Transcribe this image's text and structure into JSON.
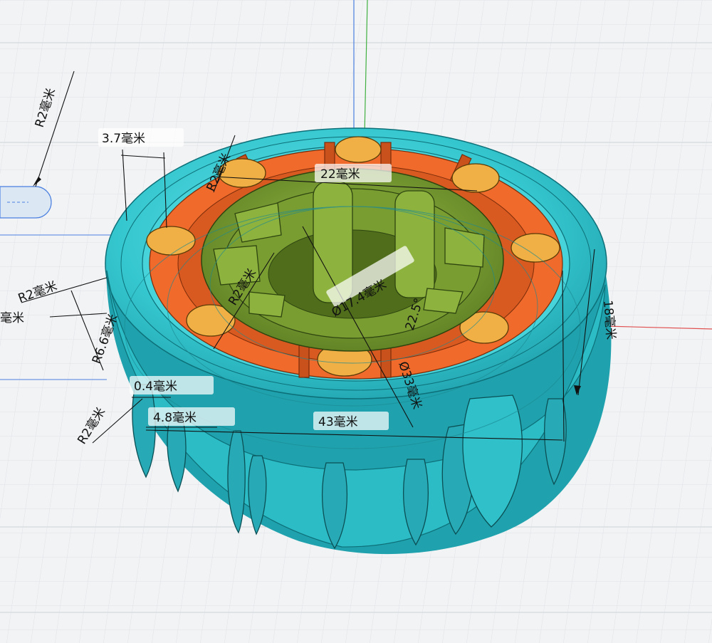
{
  "viewport": {
    "kind": "3d-cad-workspace"
  },
  "colors": {
    "background": "#f2f3f5",
    "grid_minor": "#dfe2e6",
    "grid_major": "#c9cdd3",
    "axis_x": "#e05050",
    "axis_y": "#40b040",
    "axis_z": "#4a7fe0",
    "tire": "#35c7cf",
    "tire_dark": "#1e9aa5",
    "rim_orange": "#ef6a2b",
    "pins": "#f0b045",
    "hub_green": "#6b8f2a",
    "hub_green_light": "#89ad3c"
  },
  "dimensions": {
    "r2_top_left": "R2毫米",
    "d3_7": "3.7毫米",
    "r2_upper": "R2毫米",
    "d22": "22毫米",
    "r2_hub": "R2毫米",
    "r2_left": "R2毫米",
    "cut_left": "毫米",
    "r6_6": "R6.6毫米",
    "d17_4": "Ø17.4毫米",
    "a22_5": "22.5°",
    "d33": "Ø33毫米",
    "d18": "18毫米",
    "d0_4": "0.4毫米",
    "d4_8": "4.8毫米",
    "d43": "43毫米",
    "r2_bottom": "R2毫米"
  }
}
